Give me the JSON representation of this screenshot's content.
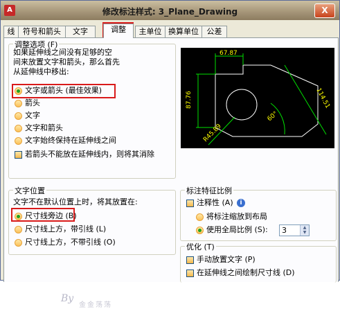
{
  "window": {
    "title": "修改标注样式: 3_Plane_Drawing",
    "close_label": "X",
    "app_icon_label": "A"
  },
  "tabs": [
    "线",
    "符号和箭头",
    "文字",
    "调整",
    "主单位",
    "换算单位",
    "公差"
  ],
  "active_tab": "调整",
  "fit_options": {
    "title": "调整选项 (F)",
    "description_lines": [
      "如果延伸线之间没有足够的空",
      "间来放置文字和箭头，那么首先",
      "从延伸线中移出:"
    ],
    "options": [
      {
        "label": "文字或箭头 (最佳效果)",
        "selected": true
      },
      {
        "label": "箭头",
        "selected": false
      },
      {
        "label": "文字",
        "selected": false
      },
      {
        "label": "文字和箭头",
        "selected": false
      },
      {
        "label": "文字始终保持在延伸线之间",
        "selected": false
      }
    ],
    "suppress_checkbox": {
      "label": "若箭头不能放在延伸线内，则将其消除",
      "checked": false
    }
  },
  "text_placement": {
    "title": "文字位置",
    "description": "文字不在默认位置上时，将其放置在:",
    "options": [
      {
        "label": "尺寸线旁边 (B)",
        "selected": true
      },
      {
        "label": "尺寸线上方，带引线 (L)",
        "selected": false
      },
      {
        "label": "尺寸线上方，不带引线 (O)",
        "selected": false
      }
    ]
  },
  "scale": {
    "title": "标注特征比例",
    "annotative": {
      "label": "注释性 (A)",
      "checked": false
    },
    "layout_option": {
      "label": "将标注缩放到布局",
      "selected": false
    },
    "overall_option": {
      "label": "使用全局比例 (S):",
      "selected": true
    },
    "overall_value": "3"
  },
  "fine_tuning": {
    "title": "优化 (T)",
    "manual": {
      "label": "手动放置文字 (P)",
      "checked": false
    },
    "draw_dim_line": {
      "label": "在延伸线之间绘制尺寸线 (D)",
      "checked": true
    }
  },
  "preview": {
    "dim_top": "67.87",
    "dim_left": "87.76",
    "dim_right": "114.51",
    "dim_angle": "60°",
    "dim_radius": "R45.89"
  },
  "watermark": {
    "text": "By",
    "sub": "金金荡荡"
  },
  "colors": {
    "highlight": "#d91a1a",
    "preview_bg": "#000000",
    "preview_dim": "#00e000",
    "preview_geom": "#ffffff",
    "preview_text": "#ffff00"
  }
}
